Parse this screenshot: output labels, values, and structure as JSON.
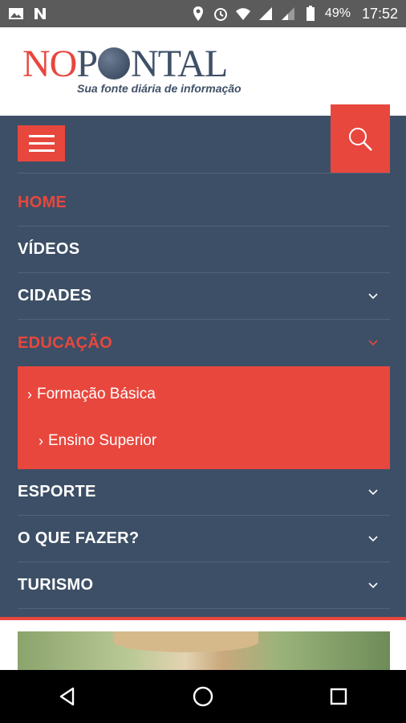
{
  "status": {
    "battery": "49%",
    "time": "17:52",
    "icons": [
      "image-icon",
      "n-icon",
      "location-icon",
      "alarm-icon",
      "wifi-icon",
      "signal-icon",
      "battery-icon"
    ]
  },
  "header": {
    "logo_no": "NO",
    "logo_p": "P",
    "logo_ntal": "NTAL",
    "tagline": "Sua fonte diária de informação"
  },
  "menu": {
    "items": [
      {
        "label": "HOME",
        "active": true
      },
      {
        "label": "VÍDEOS"
      },
      {
        "label": "CIDADES"
      },
      {
        "label": "EDUCAÇÃO",
        "active": true
      },
      {
        "label": "ESPORTE"
      },
      {
        "label": "O QUE FAZER?"
      },
      {
        "label": "TURISMO"
      }
    ],
    "submenu": [
      {
        "label": "Formação Básica"
      },
      {
        "label": "Ensino Superior"
      }
    ]
  },
  "colors": {
    "accent": "#e8473d",
    "nav_bg": "#3d4f66"
  }
}
